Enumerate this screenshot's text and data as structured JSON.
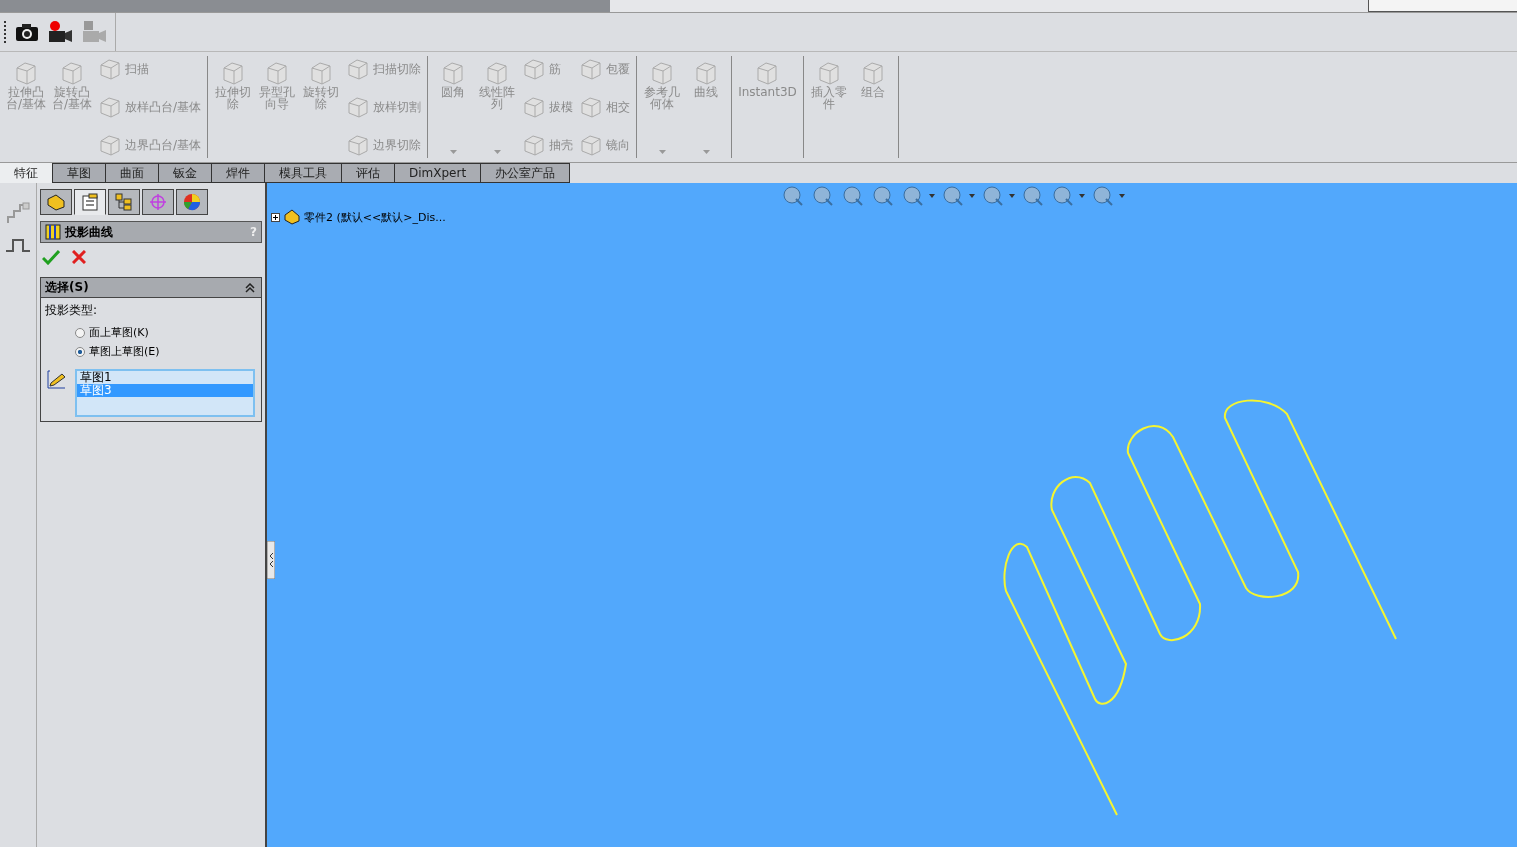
{
  "ribbon": {
    "groups": [
      {
        "columns": [
          {
            "kind": "large",
            "lines": [
              "拉伸凸",
              "台/基体"
            ],
            "dropdown": false
          },
          {
            "kind": "large",
            "lines": [
              "旋转凸",
              "台/基体"
            ],
            "dropdown": false
          },
          {
            "kind": "stack",
            "items": [
              "扫描",
              "放样凸台/基体",
              "边界凸台/基体"
            ]
          }
        ]
      },
      {
        "columns": [
          {
            "kind": "large",
            "lines": [
              "拉伸切",
              "除"
            ],
            "dropdown": false
          },
          {
            "kind": "large",
            "lines": [
              "异型孔",
              "向导"
            ],
            "dropdown": false
          },
          {
            "kind": "large",
            "lines": [
              "旋转切",
              "除"
            ],
            "dropdown": false
          },
          {
            "kind": "stack",
            "items": [
              "扫描切除",
              "放样切割",
              "边界切除"
            ]
          }
        ]
      },
      {
        "columns": [
          {
            "kind": "large",
            "lines": [
              "圆角"
            ],
            "dropdown": true
          },
          {
            "kind": "large",
            "lines": [
              "线性阵",
              "列"
            ],
            "dropdown": true
          },
          {
            "kind": "stack",
            "items": [
              "筋",
              "拔模",
              "抽壳"
            ]
          },
          {
            "kind": "stack",
            "items": [
              "包覆",
              "相交",
              "镜向"
            ]
          }
        ]
      },
      {
        "columns": [
          {
            "kind": "large",
            "lines": [
              "参考几",
              "何体"
            ],
            "dropdown": true
          },
          {
            "kind": "large",
            "lines": [
              "曲线"
            ],
            "dropdown": true
          }
        ]
      },
      {
        "columns": [
          {
            "kind": "large",
            "lines": [
              "Instant3D"
            ],
            "dropdown": false
          }
        ]
      },
      {
        "columns": [
          {
            "kind": "large",
            "lines": [
              "插入零",
              "件"
            ],
            "dropdown": false
          },
          {
            "kind": "large",
            "lines": [
              "组合"
            ],
            "dropdown": false
          }
        ]
      }
    ]
  },
  "tabs": [
    {
      "label": "特征",
      "selected": true
    },
    {
      "label": "草图",
      "selected": false
    },
    {
      "label": "曲面",
      "selected": false
    },
    {
      "label": "钣金",
      "selected": false
    },
    {
      "label": "焊件",
      "selected": false
    },
    {
      "label": "模具工具",
      "selected": false
    },
    {
      "label": "评估",
      "selected": false
    },
    {
      "label": "DimXpert",
      "selected": false
    },
    {
      "label": "办公室产品",
      "selected": false
    }
  ],
  "panel_tabs": [
    {
      "selected": false
    },
    {
      "selected": true
    },
    {
      "selected": false
    },
    {
      "selected": false
    },
    {
      "selected": false
    }
  ],
  "property_manager": {
    "title": "投影曲线",
    "help": "?",
    "section": {
      "title": "选择(S)",
      "type_label": "投影类型:",
      "options": [
        {
          "label": "面上草图(K)",
          "selected": false
        },
        {
          "label": "草图上草图(E)",
          "selected": true
        }
      ],
      "list": [
        {
          "label": "草图1",
          "selected": false
        },
        {
          "label": "草图3",
          "selected": true
        }
      ]
    }
  },
  "tree": {
    "root": "零件2 (默认<<默认>_Dis..."
  }
}
